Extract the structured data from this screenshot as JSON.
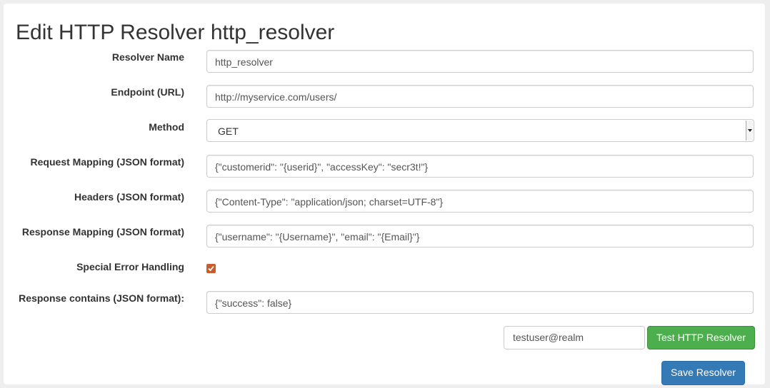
{
  "page": {
    "title": "Edit HTTP Resolver http_resolver"
  },
  "form": {
    "resolver_name": {
      "label": "Resolver Name",
      "value": "http_resolver"
    },
    "endpoint": {
      "label": "Endpoint (URL)",
      "value": "http://myservice.com/users/"
    },
    "method": {
      "label": "Method",
      "value": "GET"
    },
    "request_mapping": {
      "label": "Request Mapping (JSON format)",
      "value": "{\"customerid\": \"{userid}\", \"accessKey\": \"secr3t!\"}"
    },
    "headers": {
      "label": "Headers (JSON format)",
      "value": "{\"Content-Type\": \"application/json; charset=UTF-8\"}"
    },
    "response_mapping": {
      "label": "Response Mapping (JSON format)",
      "value": "{\"username\": \"{Username}\", \"email\": \"{Email}\"}"
    },
    "special_error_handling": {
      "label": "Special Error Handling",
      "checked": true
    },
    "response_contains": {
      "label": "Response contains (JSON format):",
      "value": "{\"success\": false}"
    }
  },
  "test": {
    "user_value": "testuser@realm",
    "button_label": "Test HTTP Resolver"
  },
  "save_button_label": "Save Resolver",
  "colors": {
    "checkbox": "#c85c2c",
    "test_button": "#4cae4c",
    "save_button": "#337ab7"
  }
}
